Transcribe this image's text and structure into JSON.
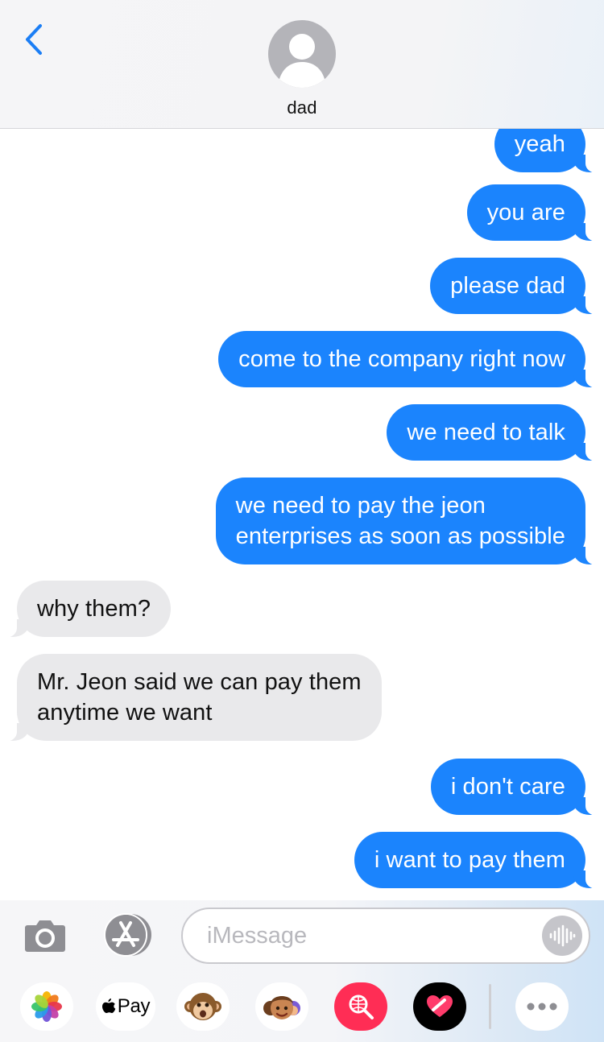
{
  "header": {
    "contact_name": "dad"
  },
  "messages": [
    {
      "from": "me",
      "text": "yeah"
    },
    {
      "from": "me",
      "text": "you are"
    },
    {
      "from": "me",
      "text": "please dad"
    },
    {
      "from": "me",
      "text": "come to the company right now"
    },
    {
      "from": "me",
      "text": "we need to talk"
    },
    {
      "from": "me",
      "lines": [
        "we need to pay the jeon",
        "enterprises as soon as possible"
      ]
    },
    {
      "from": "them",
      "text": "why them?"
    },
    {
      "from": "them",
      "lines": [
        "Mr. Jeon said we can pay them",
        "anytime we want"
      ]
    },
    {
      "from": "me",
      "text": "i don't care"
    },
    {
      "from": "me",
      "text": "i want to pay them"
    }
  ],
  "compose": {
    "placeholder": "iMessage"
  },
  "app_drawer": {
    "apple_pay_label": "Pay",
    "apps": [
      "photos-icon",
      "apple-pay-icon",
      "animoji-icon",
      "memoji-icon",
      "image-search-icon",
      "digital-touch-icon",
      "more-icon"
    ]
  },
  "colors": {
    "sent_bubble": "#1b84fd",
    "received_bubble": "#e9e9eb",
    "accent": "#1b7ef5"
  }
}
